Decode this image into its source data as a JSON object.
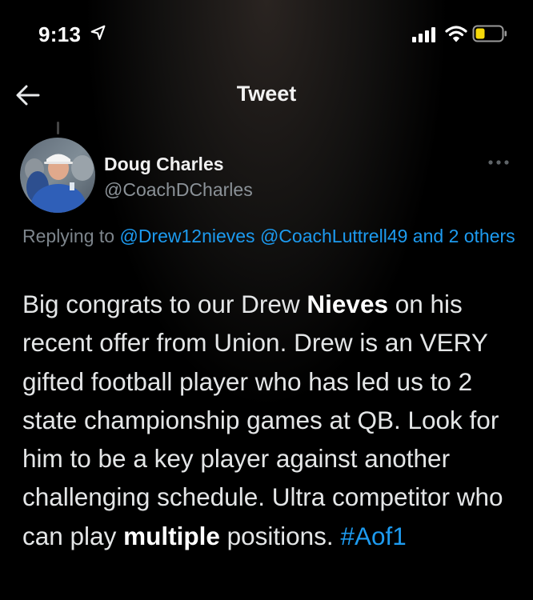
{
  "status_bar": {
    "time": "9:13",
    "location_icon": "location-arrow-icon",
    "signal_icon": "cellular-signal-icon",
    "wifi_icon": "wifi-icon",
    "battery_icon": "battery-low-icon",
    "battery_color": "#f5d90a"
  },
  "nav": {
    "back_icon": "back-arrow-icon",
    "title": "Tweet"
  },
  "tweet": {
    "author_name": "Doug Charles",
    "author_handle": "@CoachDCharles",
    "more_icon": "more-dots-icon",
    "replying_prefix": "Replying to ",
    "reply_mentions": [
      "@Drew12nieves",
      "@CoachLuttrell49"
    ],
    "reply_suffix_and": " and ",
    "reply_others": "2 others",
    "text_parts": {
      "p1": "Big congrats to our Drew ",
      "b1": "Nieves",
      "p2": " on his recent offer from Union. Drew is an VERY gifted football player who has led us to 2 state championship games at QB. Look for him to be a key player against another challenging schedule. Ultra competitor who can play ",
      "b2": "multiple",
      "p3": " positions. ",
      "hashtag": "#Aof1"
    }
  },
  "colors": {
    "background": "#000000",
    "text": "#e7e9ea",
    "secondary_text": "#8b9298",
    "link": "#1d9bf0"
  }
}
